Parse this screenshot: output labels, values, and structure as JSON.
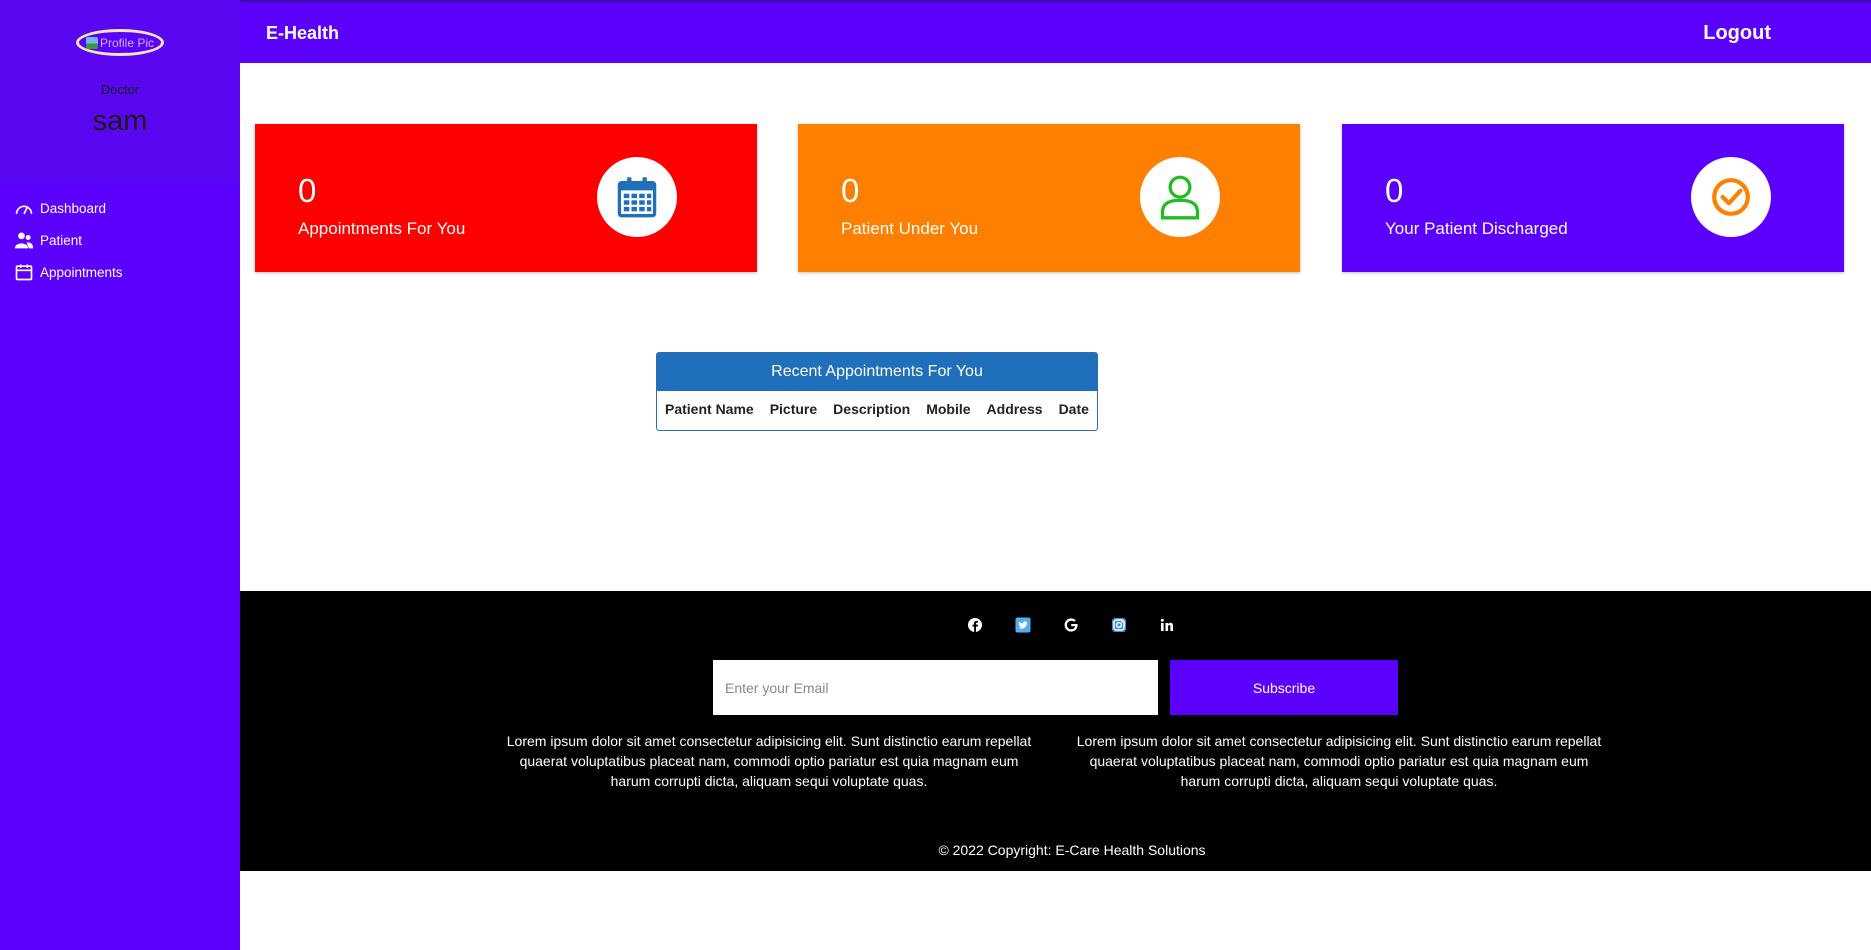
{
  "sidebar": {
    "avatar_alt": "Profile Pic",
    "role": "Doctor",
    "name": "sam",
    "items": [
      {
        "label": "Dashboard",
        "icon": "speedometer-icon"
      },
      {
        "label": "Patient",
        "icon": "users-icon"
      },
      {
        "label": "Appointments",
        "icon": "calendar-icon"
      }
    ]
  },
  "header": {
    "brand": "E-Health",
    "logout": "Logout"
  },
  "cards": [
    {
      "value": "0",
      "label": "Appointments For You",
      "color": "#ff0000",
      "icon": "calendar-icon",
      "icon_color": "#1f6fba"
    },
    {
      "value": "0",
      "label": "Patient Under You",
      "color": "#ff7f00",
      "icon": "user-icon",
      "icon_color": "#22bb22"
    },
    {
      "value": "0",
      "label": "Your Patient Discharged",
      "color": "#5c00fe",
      "icon": "check-circle-icon",
      "icon_color": "#ff7f00"
    }
  ],
  "appointments_table": {
    "title": "Recent Appointments For You",
    "columns": [
      "Patient Name",
      "Picture",
      "Description",
      "Mobile",
      "Address",
      "Date"
    ]
  },
  "footer": {
    "socials": [
      "facebook-icon",
      "twitter-icon",
      "google-icon",
      "instagram-icon",
      "linkedin-icon"
    ],
    "email_placeholder": "Enter your Email",
    "subscribe": "Subscribe",
    "text_left": "Lorem ipsum dolor sit amet consectetur adipisicing elit. Sunt distinctio earum repellat quaerat voluptatibus placeat nam, commodi optio pariatur est quia magnam eum harum corrupti dicta, aliquam sequi voluptate quas.",
    "text_right": "Lorem ipsum dolor sit amet consectetur adipisicing elit. Sunt distinctio earum repellat quaerat voluptatibus placeat nam, commodi optio pariatur est quia magnam eum harum corrupti dicta, aliquam sequi voluptate quas.",
    "copyright": "© 2022 Copyright: E-Care Health Solutions"
  },
  "colors": {
    "primary": "#5c00fe",
    "footer_bg": "#000000",
    "table_header": "#1f6fba"
  }
}
